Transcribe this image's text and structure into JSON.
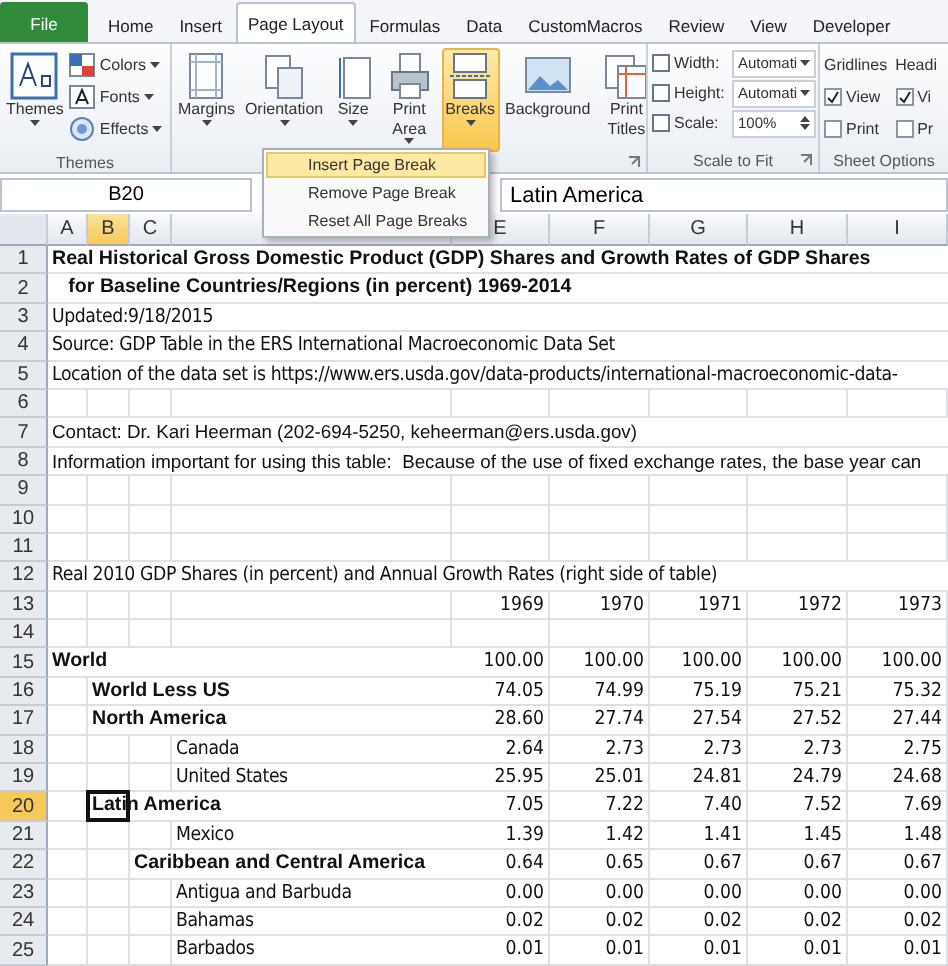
{
  "ribbon_tabs": [
    {
      "label": "File",
      "kind": "file",
      "selected": false
    },
    {
      "label": "Home",
      "kind": "tab",
      "selected": false
    },
    {
      "label": "Insert",
      "kind": "tab",
      "selected": false
    },
    {
      "label": "Page Layout",
      "kind": "tab",
      "selected": true
    },
    {
      "label": "Formulas",
      "kind": "tab",
      "selected": false
    },
    {
      "label": "Data",
      "kind": "tab",
      "selected": false
    },
    {
      "label": "CustomMacros",
      "kind": "tab",
      "selected": false
    },
    {
      "label": "Review",
      "kind": "tab",
      "selected": false
    },
    {
      "label": "View",
      "kind": "tab",
      "selected": false
    },
    {
      "label": "Developer",
      "kind": "tab",
      "selected": false
    }
  ],
  "themes_group": {
    "label": "Themes",
    "button": "Themes",
    "options": [
      {
        "label": "Colors",
        "kind": "colors"
      },
      {
        "label": "Fonts",
        "kind": "fonts"
      },
      {
        "label": "Effects",
        "kind": "effects"
      }
    ]
  },
  "page_setup_group": {
    "buttons": [
      {
        "label": "Margins",
        "kind": "margins",
        "dropdown": true,
        "selected": false
      },
      {
        "label": "Orientation",
        "kind": "orientation",
        "dropdown": true,
        "selected": false
      },
      {
        "label": "Size",
        "kind": "size",
        "dropdown": true,
        "selected": false
      },
      {
        "label": "Print Area",
        "kind": "print-area",
        "dropdown": true,
        "selected": false
      },
      {
        "label": "Breaks",
        "kind": "breaks",
        "dropdown": true,
        "selected": true
      },
      {
        "label": "Background",
        "kind": "background",
        "dropdown": false,
        "selected": false
      },
      {
        "label": "Print Titles",
        "kind": "print-titles",
        "dropdown": false,
        "selected": false
      }
    ]
  },
  "scale_to_fit_group": {
    "label": "Scale to Fit",
    "fields": [
      {
        "label": "Width:",
        "value": "Automati",
        "kind": "dropdown"
      },
      {
        "label": "Height:",
        "value": "Automati",
        "kind": "dropdown"
      },
      {
        "label": "Scale:",
        "value": "100%",
        "kind": "spinner"
      }
    ]
  },
  "sheet_options_group": {
    "label": "Sheet Options",
    "columns": [
      {
        "heading": "Gridlines",
        "options": [
          {
            "label": "View",
            "checked": true
          },
          {
            "label": "Print",
            "checked": false
          }
        ]
      },
      {
        "heading": "Headi",
        "options": [
          {
            "label": "Vi",
            "checked": true
          },
          {
            "label": "Pr",
            "checked": false
          }
        ]
      }
    ]
  },
  "breaks_menu": [
    {
      "label": "Insert Page Break",
      "selected": true
    },
    {
      "label": "Remove Page Break",
      "selected": false
    },
    {
      "label": "Reset All Page Breaks",
      "selected": false
    }
  ],
  "formula_bar": {
    "name_box": "B20",
    "value": "Latin America"
  },
  "columns": [
    {
      "label": "A",
      "selected": false
    },
    {
      "label": "B",
      "selected": true
    },
    {
      "label": "C",
      "selected": false
    },
    {
      "selected": false
    },
    {
      "label": "E",
      "selected": false
    },
    {
      "label": "F",
      "selected": false
    },
    {
      "label": "G",
      "selected": false
    },
    {
      "label": "H",
      "selected": false
    },
    {
      "label": "I",
      "selected": false
    }
  ],
  "rows": [
    {
      "number": "1",
      "selected": false,
      "text": "Real Historical Gross Domestic Product (GDP) Shares and Growth Rates of GDP Shares",
      "kind": "heading"
    },
    {
      "number": "2",
      "selected": false,
      "text": "   for Baseline Countries/Regions (in percent) 1969-2014",
      "kind": "heading"
    },
    {
      "number": "3",
      "selected": false,
      "text": "Updated:9/18/2015",
      "kind": "text"
    },
    {
      "number": "4",
      "selected": false,
      "text": "Source: GDP Table in the ERS International Macroeconomic Data Set",
      "kind": "text"
    },
    {
      "number": "5",
      "selected": false,
      "text": "Location of the data set is https://www.ers.usda.gov/data-products/international-macroeconomic-data-",
      "kind": "text"
    },
    {
      "number": "6",
      "selected": false
    },
    {
      "number": "7",
      "selected": false,
      "text": "Contact: Dr. Kari Heerman (202-694-5250, keheerman@ers.usda.gov)",
      "kind": "plain"
    },
    {
      "number": "8",
      "selected": false,
      "text": "Information important for using this table:  Because of the use of fixed exchange rates, the base year can",
      "kind": "plain"
    },
    {
      "number": "9",
      "selected": false
    },
    {
      "number": "10",
      "selected": false
    },
    {
      "number": "11",
      "selected": false
    },
    {
      "number": "12",
      "selected": false,
      "text": "Real 2010 GDP Shares (in percent) and Annual Growth Rates (right side of table)",
      "kind": "text"
    },
    {
      "number": "13",
      "selected": false,
      "values": [
        "1969",
        "1970",
        "1971",
        "1972",
        "1973"
      ]
    },
    {
      "number": "14",
      "selected": false
    },
    {
      "number": "15",
      "selected": false,
      "text": "World",
      "kind": "heading",
      "values": [
        "100.00",
        "100.00",
        "100.00",
        "100.00",
        "100.00"
      ]
    },
    {
      "number": "16",
      "selected": false,
      "text": "World Less US",
      "kind": "region",
      "values": [
        "74.05",
        "74.99",
        "75.19",
        "75.21",
        "75.32"
      ]
    },
    {
      "number": "17",
      "selected": false,
      "text": "North America",
      "kind": "region",
      "values": [
        "28.60",
        "27.74",
        "27.54",
        "27.52",
        "27.44"
      ]
    },
    {
      "number": "18",
      "selected": false,
      "text": "Canada",
      "kind": "country",
      "values": [
        "2.64",
        "2.73",
        "2.73",
        "2.73",
        "2.75"
      ]
    },
    {
      "number": "19",
      "selected": false,
      "text": "United States",
      "kind": "country",
      "values": [
        "25.95",
        "25.01",
        "24.81",
        "24.79",
        "24.68"
      ]
    },
    {
      "number": "20",
      "selected": true,
      "text": "Latin America",
      "kind": "region",
      "values": [
        "7.05",
        "7.22",
        "7.40",
        "7.52",
        "7.69"
      ]
    },
    {
      "number": "21",
      "selected": false,
      "text": "Mexico",
      "kind": "country",
      "values": [
        "1.39",
        "1.42",
        "1.41",
        "1.45",
        "1.48"
      ]
    },
    {
      "number": "22",
      "selected": false,
      "text": "Caribbean and Central America",
      "kind": "subregion",
      "values": [
        "0.64",
        "0.65",
        "0.67",
        "0.67",
        "0.67"
      ]
    },
    {
      "number": "23",
      "selected": false,
      "text": "Antigua and Barbuda",
      "kind": "country",
      "values": [
        "0.00",
        "0.00",
        "0.00",
        "0.00",
        "0.00"
      ]
    },
    {
      "number": "24",
      "selected": false,
      "text": "Bahamas",
      "kind": "country",
      "values": [
        "0.02",
        "0.02",
        "0.02",
        "0.02",
        "0.02"
      ]
    },
    {
      "number": "25",
      "selected": false,
      "text": "Barbados",
      "kind": "country",
      "values": [
        "0.01",
        "0.01",
        "0.01",
        "0.01",
        "0.01"
      ]
    }
  ]
}
